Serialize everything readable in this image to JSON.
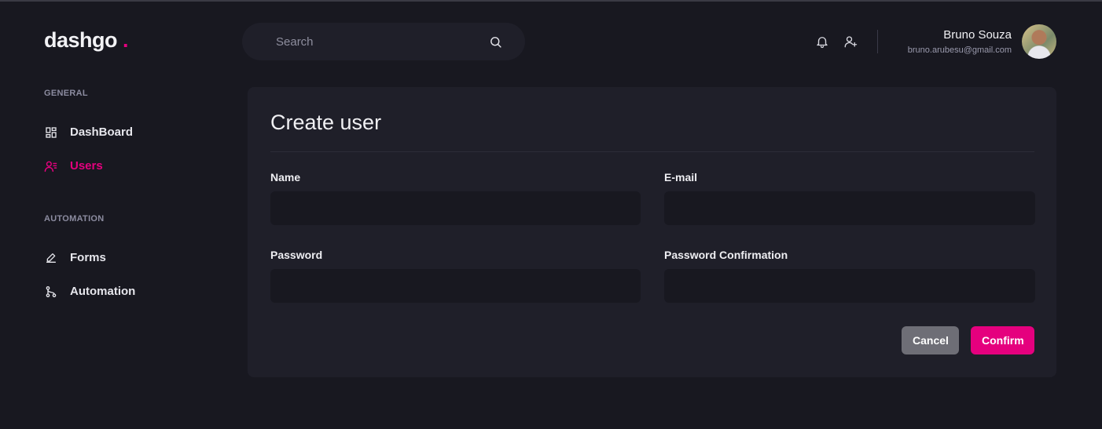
{
  "brand": {
    "logo_text": "dashgo",
    "logo_dot": ".",
    "accent_color": "#e5007e"
  },
  "search": {
    "placeholder": "Search",
    "value": "",
    "icon": "search-icon"
  },
  "header": {
    "icons": [
      "bell-icon",
      "user-plus-icon"
    ],
    "user": {
      "name": "Bruno Souza",
      "email": "bruno.arubesu@gmail.com"
    }
  },
  "sidebar": {
    "sections": [
      {
        "title": "GENERAL",
        "items": [
          {
            "label": "DashBoard",
            "icon": "dashboard-icon",
            "active": false
          },
          {
            "label": "Users",
            "icon": "users-icon",
            "active": true
          }
        ]
      },
      {
        "title": "AUTOMATION",
        "items": [
          {
            "label": "Forms",
            "icon": "edit-icon",
            "active": false
          },
          {
            "label": "Automation",
            "icon": "git-branch-icon",
            "active": false
          }
        ]
      }
    ]
  },
  "form": {
    "title": "Create user",
    "fields": {
      "name": {
        "label": "Name",
        "value": ""
      },
      "email": {
        "label": "E-mail",
        "value": ""
      },
      "password": {
        "label": "Password",
        "value": ""
      },
      "password_confirmation": {
        "label": "Password Confirmation",
        "value": ""
      }
    },
    "cancel_label": "Cancel",
    "confirm_label": "Confirm"
  }
}
